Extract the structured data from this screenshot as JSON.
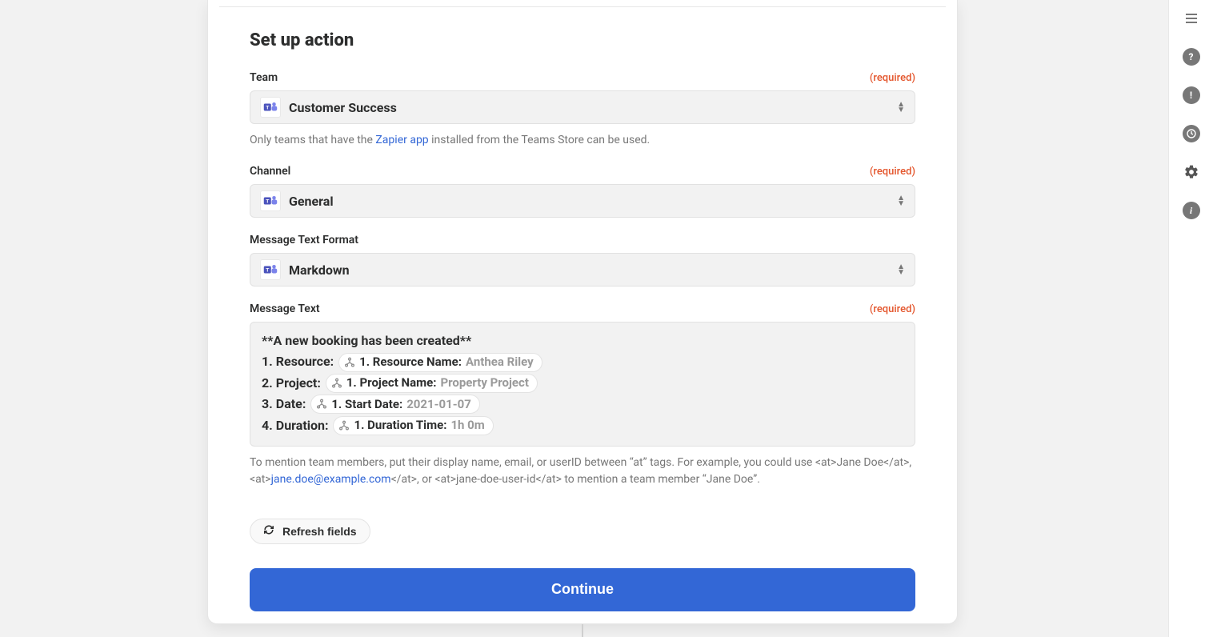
{
  "title": "Set up action",
  "required_label": "(required)",
  "fields": {
    "team": {
      "label": "Team",
      "value": "Customer Success",
      "help_prefix": "Only teams that have the ",
      "help_link": "Zapier app",
      "help_suffix": " installed from the Teams Store can be used."
    },
    "channel": {
      "label": "Channel",
      "value": "General"
    },
    "format": {
      "label": "Message Text Format",
      "value": "Markdown"
    },
    "message": {
      "label": "Message Text",
      "line1": "**A new booking has been created**",
      "lines": [
        {
          "prefix": "1. Resource:",
          "pill_label": "1. Resource Name:",
          "pill_value": "Anthea Riley"
        },
        {
          "prefix": "2. Project:",
          "pill_label": "1. Project Name:",
          "pill_value": "Property Project"
        },
        {
          "prefix": "3. Date:",
          "pill_label": "1. Start Date:",
          "pill_value": "2021-01-07"
        },
        {
          "prefix": "4. Duration:",
          "pill_label": "1. Duration Time:",
          "pill_value": "1h 0m"
        }
      ],
      "help_prefix": "To mention team members, put their display name, email, or userID between “at” tags. For example, you could use <at>Jane Doe</at>, <at>",
      "help_link": "jane.doe@example.com",
      "help_suffix": "</at>, or <at>jane-doe-user-id</at> to mention a team member “Jane Doe”."
    }
  },
  "buttons": {
    "refresh": "Refresh fields",
    "continue": "Continue"
  }
}
